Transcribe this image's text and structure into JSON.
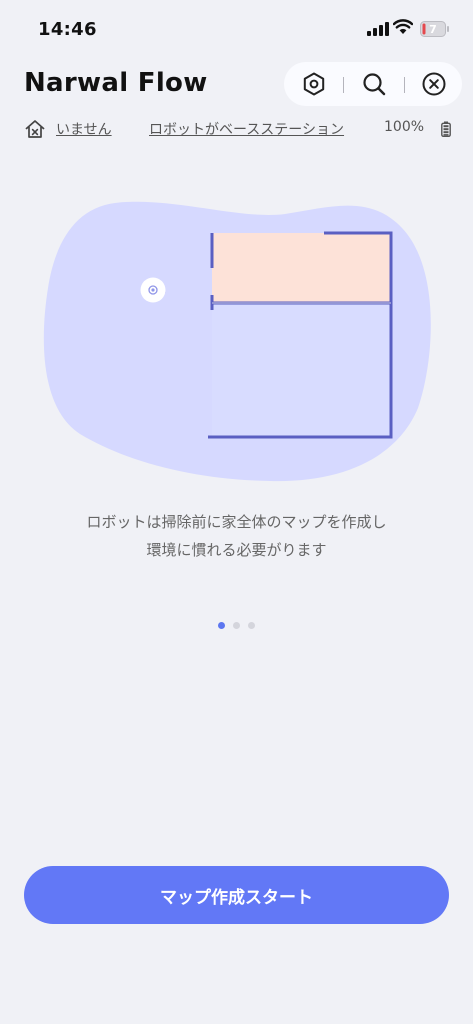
{
  "status_bar": {
    "time": "14:46",
    "battery_level": "7"
  },
  "header": {
    "title": "Narwal Flow"
  },
  "icons": {
    "settings": "hexagon-settings-icon",
    "search": "search-icon",
    "close": "close-circle-icon",
    "home": "home-x-icon",
    "battery": "battery-icon"
  },
  "device_status": {
    "presence": "いません",
    "message": "ロボットがベースステーション",
    "battery": "100%"
  },
  "onboarding": {
    "caption_line1": "ロボットは掃除前に家全体のマップを作成し",
    "caption_line2": "環境に慣れる必要がります",
    "page_count": 3,
    "active_page": 1
  },
  "cta": {
    "label": "マップ作成スタート"
  },
  "colors": {
    "accent": "#6278f6",
    "blob": "#d6d9ff",
    "room": "#fde2d8",
    "wall": "#5a5fc2",
    "background": "#f0f1f6"
  }
}
